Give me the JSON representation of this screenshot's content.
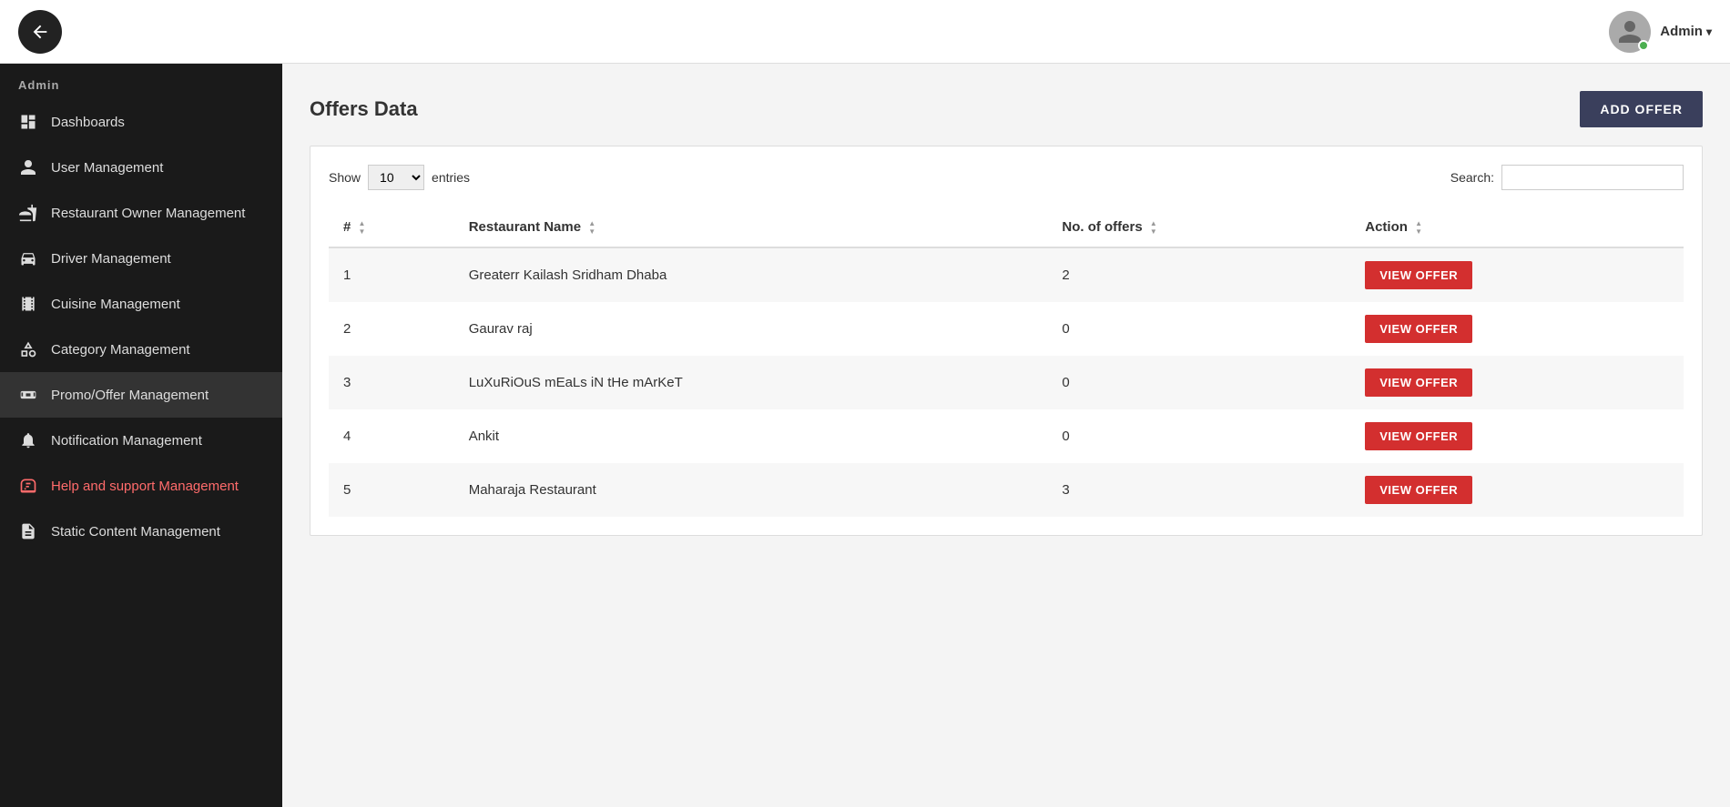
{
  "topbar": {
    "toggle_icon": "←",
    "admin_name": "Admin",
    "chevron": "▾"
  },
  "sidebar": {
    "admin_label": "Admin",
    "items": [
      {
        "id": "dashboards",
        "label": "Dashboards",
        "icon": "dashboard"
      },
      {
        "id": "user-management",
        "label": "User Management",
        "icon": "user"
      },
      {
        "id": "restaurant-owner-management",
        "label": "Restaurant Owner Management",
        "icon": "restaurant"
      },
      {
        "id": "driver-management",
        "label": "Driver Management",
        "icon": "driver"
      },
      {
        "id": "cuisine-management",
        "label": "Cuisine Management",
        "icon": "cuisine"
      },
      {
        "id": "category-management",
        "label": "Category Management",
        "icon": "category"
      },
      {
        "id": "promo-offer-management",
        "label": "Promo/Offer Management",
        "icon": "promo",
        "active": true
      },
      {
        "id": "notification-management",
        "label": "Notification Management",
        "icon": "notification"
      },
      {
        "id": "help-support-management",
        "label": "Help and support Management",
        "icon": "help",
        "highlight": true
      },
      {
        "id": "static-content-management",
        "label": "Static Content Management",
        "icon": "static"
      }
    ]
  },
  "main": {
    "page_title": "Offers Data",
    "add_offer_label": "ADD OFFER",
    "show_label": "Show",
    "entries_label": "entries",
    "search_label": "Search:",
    "show_value": "10",
    "table": {
      "columns": [
        "#",
        "Restaurant Name",
        "No. of offers",
        "Action"
      ],
      "rows": [
        {
          "num": "1",
          "name": "Greaterr Kailash Sridham Dhaba",
          "offers": "2",
          "action": "VIEW OFFER"
        },
        {
          "num": "2",
          "name": "Gaurav raj",
          "offers": "0",
          "action": "VIEW OFFER"
        },
        {
          "num": "3",
          "name": "LuXuRiOuS mEaLs iN tHe mArKeT",
          "offers": "0",
          "action": "VIEW OFFER"
        },
        {
          "num": "4",
          "name": "Ankit",
          "offers": "0",
          "action": "VIEW OFFER"
        },
        {
          "num": "5",
          "name": "Maharaja Restaurant",
          "offers": "3",
          "action": "VIEW OFFER"
        }
      ]
    }
  }
}
